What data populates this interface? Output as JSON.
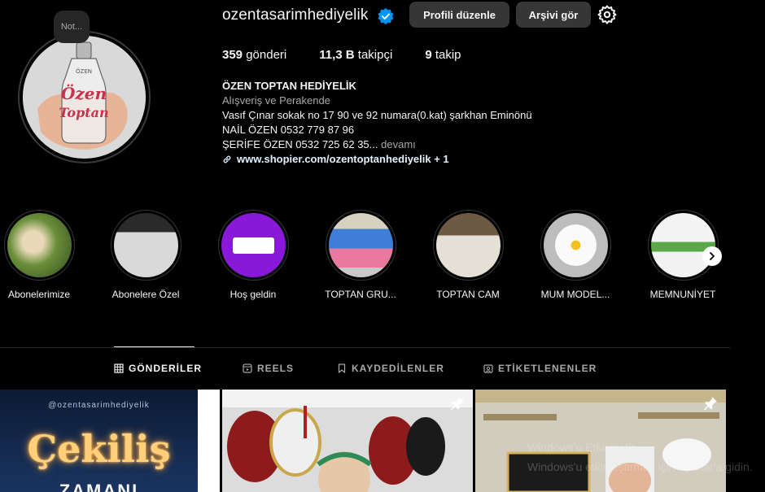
{
  "profile": {
    "note": "Not...",
    "username": "ozentasarimhediyelik",
    "edit_button": "Profili düzenle",
    "archive_button": "Arşivi gör",
    "stats": [
      {
        "value": "359",
        "label": "gönderi"
      },
      {
        "value": "11,3 B",
        "label": "takipçi"
      },
      {
        "value": "9",
        "label": "takip"
      }
    ],
    "bio": {
      "name": "ÖZEN TOPTAN HEDİYELİK",
      "category": "Alışveriş ve Perakende",
      "line1": "Vasıf Çınar sokak no 17 90 ve 92 numara(0.kat) şarkhan Eminönü",
      "line2": "NAİL ÖZEN 0532 779 87 96",
      "line3": "ŞERİFE ÖZEN 0532 725 62 35...",
      "more": "devamı",
      "link": "www.shopier.com/ozentoptanhediyelik + 1"
    }
  },
  "avatar_text": {
    "top": "ÖZEN",
    "mid": "Özen",
    "bot": "Toptan"
  },
  "highlights": [
    {
      "label": "Abonelerimize"
    },
    {
      "label": "Abonelere Özel"
    },
    {
      "label": "Hoş geldin"
    },
    {
      "label": "TOPTAN GRU..."
    },
    {
      "label": "TOPTAN CAM"
    },
    {
      "label": "MUM MODEL..."
    },
    {
      "label": "MEMNUNİYET"
    }
  ],
  "tabs": [
    {
      "label": "GÖNDERİLER",
      "icon": "grid-icon",
      "active": true
    },
    {
      "label": "REELS",
      "icon": "reels-icon",
      "active": false
    },
    {
      "label": "KAYDEDİLENLER",
      "icon": "bookmark-icon",
      "active": false
    },
    {
      "label": "ETİKETLENENLER",
      "icon": "tag-icon",
      "active": false
    }
  ],
  "posts": {
    "post1_handle": "@ozentasarimhediyelik",
    "post1_title": "Çekiliş",
    "post1_sub": "ZAMANI"
  },
  "watermark": {
    "line1": "Windows'u Etkinleştir",
    "line2": "Windows'u etkinleştirmek için Ayarlar'a gidin."
  },
  "colors": {
    "background": "#000000",
    "button": "#363636",
    "verified": "#0095f6",
    "secondary_text": "#a8a8a8"
  }
}
